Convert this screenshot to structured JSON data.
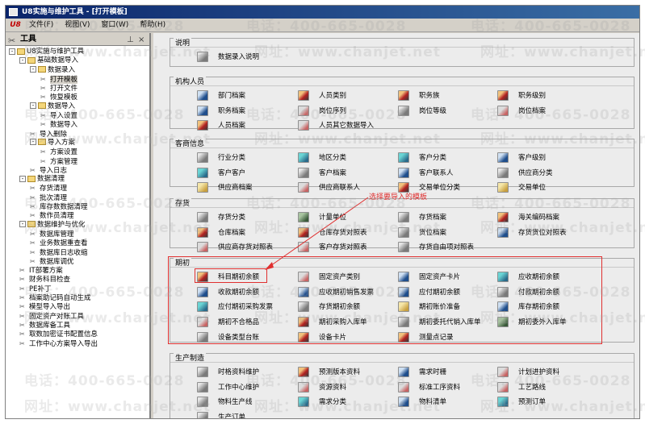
{
  "window": {
    "title": "U8实施与维护工具 - [打开模板]"
  },
  "menubar": {
    "logo": "U8",
    "items": [
      "文件(F)",
      "视图(V)",
      "窗口(W)",
      "帮助(H)"
    ]
  },
  "left_pane": {
    "title": "工具",
    "pin": "⊥",
    "close": "×",
    "tree": [
      {
        "label": "U8实施与维护工具",
        "level": 0,
        "type": "folder",
        "toggle": "-"
      },
      {
        "label": "基础数据导入",
        "level": 1,
        "type": "folder",
        "toggle": "-"
      },
      {
        "label": "数据录入",
        "level": 2,
        "type": "folder",
        "toggle": "-"
      },
      {
        "label": "打开模板",
        "level": 3,
        "type": "leaf",
        "selected": true
      },
      {
        "label": "打开文件",
        "level": 3,
        "type": "leaf"
      },
      {
        "label": "恢复模板",
        "level": 3,
        "type": "leaf"
      },
      {
        "label": "数据导入",
        "level": 2,
        "type": "folder",
        "toggle": "-"
      },
      {
        "label": "导入设置",
        "level": 3,
        "type": "leaf"
      },
      {
        "label": "数据导入",
        "level": 3,
        "type": "leaf"
      },
      {
        "label": "导入删除",
        "level": 2,
        "type": "leaf"
      },
      {
        "label": "导入方案",
        "level": 2,
        "type": "folder",
        "toggle": "-"
      },
      {
        "label": "方案设置",
        "level": 3,
        "type": "leaf"
      },
      {
        "label": "方案管理",
        "level": 3,
        "type": "leaf"
      },
      {
        "label": "导入日志",
        "level": 2,
        "type": "leaf"
      },
      {
        "label": "数据清理",
        "level": 1,
        "type": "folder",
        "toggle": "-"
      },
      {
        "label": "存货清理",
        "level": 2,
        "type": "leaf"
      },
      {
        "label": "批次清理",
        "level": 2,
        "type": "leaf"
      },
      {
        "label": "库存数数据清理",
        "level": 2,
        "type": "leaf"
      },
      {
        "label": "数作员清理",
        "level": 2,
        "type": "leaf"
      },
      {
        "label": "数据维护与优化",
        "level": 1,
        "type": "folder",
        "toggle": "-"
      },
      {
        "label": "数据库管理",
        "level": 2,
        "type": "leaf"
      },
      {
        "label": "业务数据重查看",
        "level": 2,
        "type": "leaf"
      },
      {
        "label": "数据库日志收缩",
        "level": 2,
        "type": "leaf"
      },
      {
        "label": "数据库调优",
        "level": 2,
        "type": "leaf"
      },
      {
        "label": "IT部署方案",
        "level": 1,
        "type": "leaf"
      },
      {
        "label": "财务科目检查",
        "level": 1,
        "type": "leaf"
      },
      {
        "label": "PE补丁",
        "level": 1,
        "type": "leaf"
      },
      {
        "label": "档案助记码自动生成",
        "level": 1,
        "type": "leaf"
      },
      {
        "label": "模型导入导出",
        "level": 1,
        "type": "leaf"
      },
      {
        "label": "固定资产对账工具",
        "level": 1,
        "type": "leaf"
      },
      {
        "label": "数据库备工具",
        "level": 1,
        "type": "leaf"
      },
      {
        "label": "取数加密证书配置信息",
        "level": 1,
        "type": "leaf"
      },
      {
        "label": "工作中心方案导入导出",
        "level": 1,
        "type": "leaf"
      }
    ]
  },
  "groups": [
    {
      "title": "说明",
      "items": [
        {
          "label": "数据录入说明",
          "icon": "c"
        }
      ]
    },
    {
      "title": "机构人员",
      "items": [
        {
          "label": "部门档案",
          "icon": "b"
        },
        {
          "label": "人员类别",
          "icon": "a"
        },
        {
          "label": "职务族",
          "icon": "a"
        },
        {
          "label": "职务级别",
          "icon": "a"
        },
        {
          "label": "职务档案",
          "icon": "b"
        },
        {
          "label": "岗位序列",
          "icon": "d"
        },
        {
          "label": "岗位等级",
          "icon": "c"
        },
        {
          "label": "岗位档案",
          "icon": "d"
        },
        {
          "label": "人员档案",
          "icon": "a"
        },
        {
          "label": "人员其它数据导入",
          "icon": "d"
        }
      ]
    },
    {
      "title": "客商信息",
      "items": [
        {
          "label": "行业分类",
          "icon": "c"
        },
        {
          "label": "地区分类",
          "icon": "e"
        },
        {
          "label": "客户分类",
          "icon": "e"
        },
        {
          "label": "客户级别",
          "icon": "b"
        },
        {
          "label": "客户客户",
          "icon": "e"
        },
        {
          "label": "客户档案",
          "icon": "c"
        },
        {
          "label": "客户联系人",
          "icon": "b"
        },
        {
          "label": "供应商分类",
          "icon": "c"
        },
        {
          "label": "供应商档案",
          "icon": "f"
        },
        {
          "label": "供应商联系人",
          "icon": "d"
        },
        {
          "label": "交易单位分类",
          "icon": "a"
        },
        {
          "label": "交易单位",
          "icon": "f"
        }
      ]
    },
    {
      "title": "存货",
      "items": [
        {
          "label": "存货分类",
          "icon": "c"
        },
        {
          "label": "计量单位",
          "icon": "g"
        },
        {
          "label": "存货档案",
          "icon": "c"
        },
        {
          "label": "海关编码档案",
          "icon": "a"
        },
        {
          "label": "仓库档案",
          "icon": "a"
        },
        {
          "label": "仓库存货对照表",
          "icon": "a"
        },
        {
          "label": "货位档案",
          "icon": "c"
        },
        {
          "label": "存货货位对照表",
          "icon": "b"
        },
        {
          "label": "供应商存货对照表",
          "icon": "d"
        },
        {
          "label": "客户存货对照表",
          "icon": "d"
        },
        {
          "label": "存货自由项对照表",
          "icon": "c"
        }
      ]
    },
    {
      "title": "期初",
      "items": [
        {
          "label": "科目期初余额",
          "icon": "a"
        },
        {
          "label": "固定资产类别",
          "icon": "d"
        },
        {
          "label": "固定资产卡片",
          "icon": "b"
        },
        {
          "label": "应收期初余额",
          "icon": "e"
        },
        {
          "label": "收款期初余额",
          "icon": "b"
        },
        {
          "label": "应收期初销售发票",
          "icon": "b"
        },
        {
          "label": "应付期初余额",
          "icon": "b"
        },
        {
          "label": "付款期初余额",
          "icon": "c"
        },
        {
          "label": "应付期初采购发票",
          "icon": "e"
        },
        {
          "label": "存货期初余额",
          "icon": "c"
        },
        {
          "label": "期初账价准备",
          "icon": "f"
        },
        {
          "label": "库存期初余额",
          "icon": "b"
        },
        {
          "label": "期初不合格品",
          "icon": "d"
        },
        {
          "label": "期初采购入库单",
          "icon": "a"
        },
        {
          "label": "期初委托代销入库单",
          "icon": "c"
        },
        {
          "label": "期初委外入库单",
          "icon": "g"
        },
        {
          "label": "设备类型台账",
          "icon": "c"
        },
        {
          "label": "设备卡片",
          "icon": "a"
        },
        {
          "label": "测量点记录",
          "icon": "a"
        }
      ]
    },
    {
      "title": "生产制造",
      "items": [
        {
          "label": "时格资料维护",
          "icon": "c"
        },
        {
          "label": "预测版本资料",
          "icon": "a"
        },
        {
          "label": "需求时栅",
          "icon": "b"
        },
        {
          "label": "计划进护资料",
          "icon": "d"
        },
        {
          "label": "工作中心维护",
          "icon": "c"
        },
        {
          "label": "资源资料",
          "icon": "d"
        },
        {
          "label": "标准工序资料",
          "icon": "d"
        },
        {
          "label": "工艺路线",
          "icon": "d"
        },
        {
          "label": "物料生产线",
          "icon": "c"
        },
        {
          "label": "需求分类",
          "icon": "e"
        },
        {
          "label": "物料清单",
          "icon": "b"
        },
        {
          "label": "预测订单",
          "icon": "e"
        },
        {
          "label": "生产订单",
          "icon": "c"
        }
      ]
    }
  ],
  "annotation": {
    "text": "选择要导入的模板"
  },
  "watermark": {
    "phone": "电话：400-665-0028",
    "site": "网址：www.chanjet.net"
  }
}
